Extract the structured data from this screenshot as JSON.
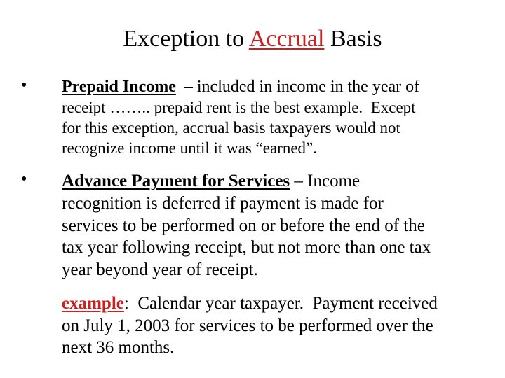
{
  "slide": {
    "title": {
      "before": "Exception to ",
      "highlight": "Accrual",
      "after": " Basis"
    },
    "bullets": [
      {
        "term": "Prepaid Income",
        "dash_text": "  – included in income in the year of",
        "lines": [
          "receipt …….. prepaid rent is the best example.  Except",
          "for this exception, accrual basis taxpayers would not",
          "recognize income until it was “earned”."
        ]
      },
      {
        "term": "Advance Payment for Services",
        "dash_text": " – Income",
        "lines": [
          "recognition is deferred if payment is made for",
          "services to be performed on or before the end of the",
          "tax year following receipt, but not more than one tax",
          "year beyond year of receipt."
        ]
      }
    ],
    "example": {
      "label": "example",
      "first_text": ":  Calendar year taxpayer.  Payment received",
      "lines": [
        "on July 1, 2003 for services to be performed over the",
        "next 36 months."
      ]
    },
    "bullet_glyph": "•",
    "colors": {
      "accent": "#cc1f1f",
      "text": "#000000",
      "background": "#ffffff"
    }
  }
}
